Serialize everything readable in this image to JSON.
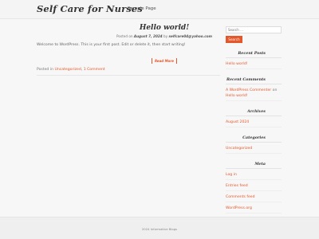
{
  "header": {
    "site_title": "Self Care for Nurses",
    "nav": [
      "Sample Page"
    ]
  },
  "post": {
    "title": "Hello world!",
    "meta_prefix": "Posted on",
    "date": "August 7, 2024",
    "meta_by": "by",
    "author": "selfcare04@yahoo.com",
    "body": "Welcome to WordPress. This is your first post. Edit or delete it, then start writing!",
    "read_more": "Read More",
    "posted_in": "Posted in",
    "category": "Uncategorized",
    "comments": "1 Comment"
  },
  "sidebar": {
    "search_placeholder": "Search …",
    "search_button": "Search",
    "recent_posts_title": "Recent Posts",
    "recent_posts": [
      "Hello world!"
    ],
    "recent_comments_title": "Recent Comments",
    "recent_comment_author": "A WordPress Commenter",
    "recent_comment_on": "on",
    "recent_comment_post": "Hello world!",
    "archives_title": "Archives",
    "archives": [
      "August 2024"
    ],
    "categories_title": "Categories",
    "categories": [
      "Uncategorized"
    ],
    "meta_title": "Meta",
    "meta_links": [
      "Log in",
      "Entries feed",
      "Comments feed",
      "WordPress.org"
    ]
  },
  "footer": {
    "text": "2024 Informative Blogs"
  },
  "colors": {
    "accent": "#e3572a",
    "background": "#f7f7f7"
  }
}
